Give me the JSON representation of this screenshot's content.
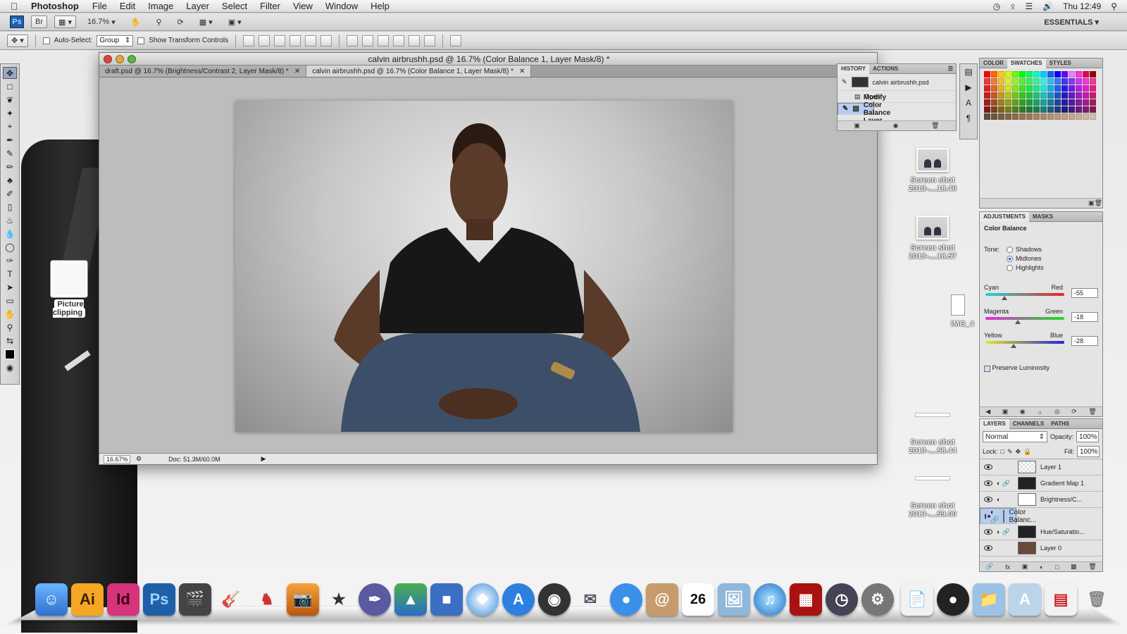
{
  "menubar": {
    "app_name": "Photoshop",
    "items": [
      "File",
      "Edit",
      "Image",
      "Layer",
      "Select",
      "Filter",
      "View",
      "Window",
      "Help"
    ],
    "clock": "Thu 12:49"
  },
  "appbar": {
    "zoom": "16.7%",
    "workspace": "ESSENTIALS"
  },
  "options": {
    "auto_select_label": "Auto-Select:",
    "auto_select_value": "Group",
    "transform_label": "Show Transform Controls"
  },
  "document": {
    "window_title": "calvin airbrushh.psd @ 16.7% (Color Balance 1, Layer Mask/8) *",
    "tabs": [
      {
        "label": "draft.psd @ 16.7% (Brightness/Contrast 2, Layer Mask/8) *"
      },
      {
        "label": "calvin airbrushh.psd @ 16.7% (Color Balance 1, Layer Mask/8) *"
      }
    ],
    "status_zoom": "16.67%",
    "status_doc": "Doc: 51.3M/60.0M"
  },
  "history": {
    "tabs": [
      "HISTORY",
      "ACTIONS"
    ],
    "snapshot": "calvin airbrushh.psd",
    "steps": [
      "Open",
      "Modify Color Balance Layer"
    ]
  },
  "swatches_panel": {
    "tabs": [
      "COLOR",
      "SWATCHES",
      "STYLES"
    ]
  },
  "adjustments": {
    "tabs": [
      "ADJUSTMENTS",
      "MASKS"
    ],
    "title": "Color Balance",
    "tone_label": "Tone:",
    "tones": [
      "Shadows",
      "Midtones",
      "Highlights"
    ],
    "selected_tone": "Midtones",
    "sliders": [
      {
        "left": "Cyan",
        "right": "Red",
        "value": "-55",
        "level": 0.24
      },
      {
        "left": "Magenta",
        "right": "Green",
        "value": "-18",
        "level": 0.41
      },
      {
        "left": "Yellow",
        "right": "Blue",
        "value": "-28",
        "level": 0.36
      }
    ],
    "preserve_label": "Preserve Luminosity"
  },
  "layers_panel": {
    "tabs": [
      "LAYERS",
      "CHANNELS",
      "PATHS"
    ],
    "blend_mode": "Normal",
    "opacity_label": "Opacity:",
    "opacity": "100%",
    "lock_label": "Lock:",
    "fill_label": "Fill:",
    "fill": "100%",
    "layers": [
      {
        "name": "Layer 1"
      },
      {
        "name": "Gradient Map 1"
      },
      {
        "name": "Brightness/C..."
      },
      {
        "name": "Color Balanc..."
      },
      {
        "name": "Hue/Saturatio..."
      },
      {
        "name": "Layer 0"
      }
    ]
  },
  "desktop": {
    "clipping_label": "Picture clipping",
    "files": [
      {
        "line1": "Screen shot",
        "line2": "2013-....18.46"
      },
      {
        "line1": "Screen shot",
        "line2": "2013-....18.57"
      },
      {
        "line1": "Screen shot",
        "line2": "2013-....58.44"
      },
      {
        "line1": "Screen shot",
        "line2": "2013-....59.00"
      }
    ],
    "partial_file": "IMG_4"
  },
  "dock": {
    "icons": [
      "finder-icon",
      "illustrator-icon",
      "indesign-icon",
      "photoshop-icon",
      "final-cut-icon",
      "garageband-icon",
      "gnome-icon",
      "iphoto-icon",
      "imovie-icon",
      "pen-tool-icon",
      "numbers-icon",
      "keynote-icon",
      "safari-icon",
      "app-store-icon",
      "dashboard-icon",
      "mail-icon",
      "ichat-icon",
      "address-book-icon",
      "ical-icon",
      "preview-icon",
      "itunes-icon",
      "photo-booth-icon",
      "time-machine-icon",
      "system-prefs-icon",
      "documents-stack-icon",
      "downloads-stack-icon",
      "applications-folder-icon",
      "stack-icon",
      "trash-icon"
    ],
    "labels": {
      "illustrator": "Ai",
      "indesign": "Id",
      "photoshop": "Ps",
      "calendar_day": "26"
    }
  },
  "colors": {
    "selected_row": "#b6cdf0",
    "ps_blue": "#1f5fa8",
    "illustrator": "#f5a623",
    "indesign": "#d6337b"
  }
}
